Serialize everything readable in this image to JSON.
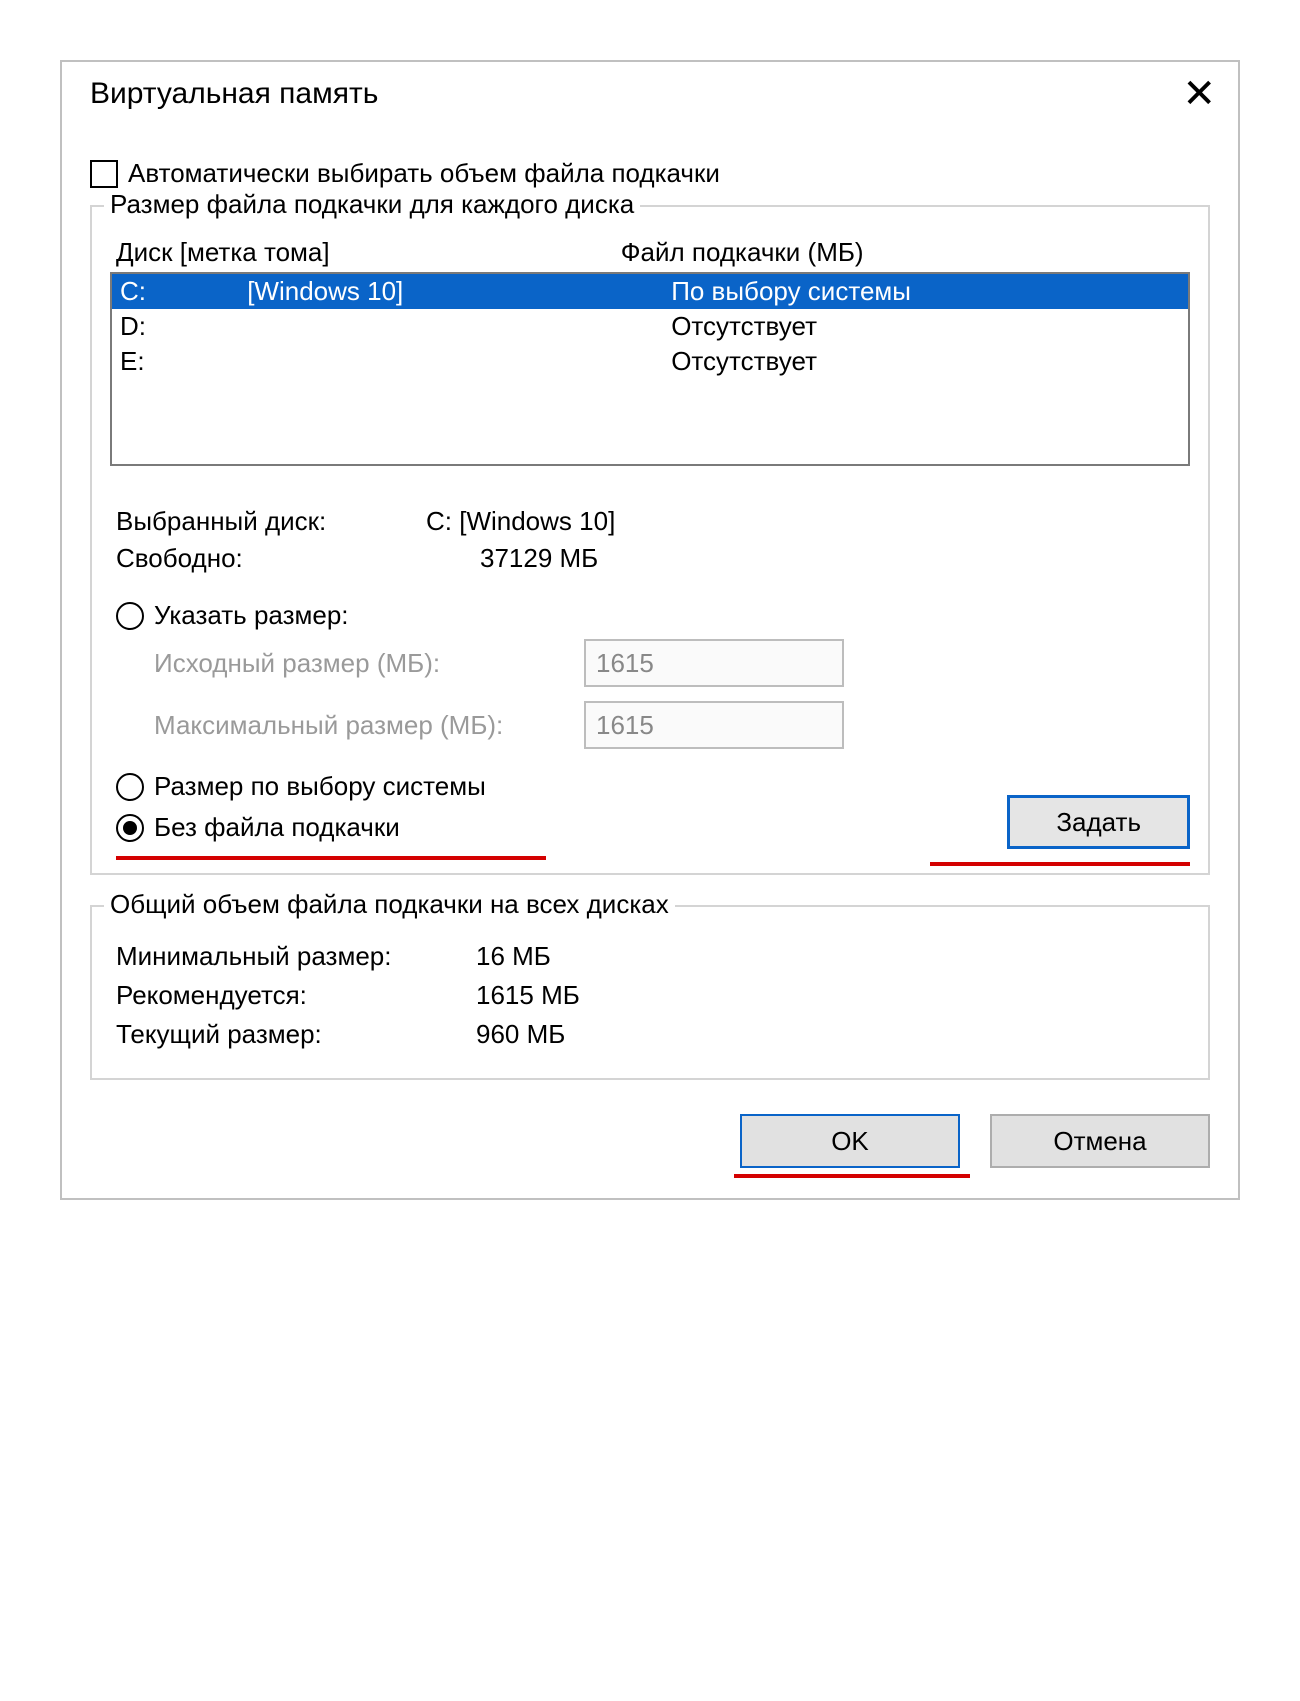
{
  "window": {
    "title": "Виртуальная память"
  },
  "auto_checkbox": {
    "label": "Автоматически выбирать объем файла подкачки",
    "checked": false
  },
  "drive_group": {
    "legend": "Размер файла подкачки для каждого диска",
    "header": {
      "col1": "Диск [метка тома]",
      "col2": "Файл подкачки (МБ)"
    },
    "rows": [
      {
        "drive": "C:",
        "label": "[Windows 10]",
        "status": "По выбору системы",
        "selected": true
      },
      {
        "drive": "D:",
        "label": "",
        "status": "Отсутствует",
        "selected": false
      },
      {
        "drive": "E:",
        "label": "",
        "status": "Отсутствует",
        "selected": false
      }
    ]
  },
  "selected_drive": {
    "label": "Выбранный диск:",
    "value": "C:  [Windows 10]"
  },
  "free_space": {
    "label": "Свободно:",
    "value": "37129 МБ"
  },
  "radio_custom": {
    "label": "Указать размер:"
  },
  "initial_size": {
    "label": "Исходный размер (МБ):",
    "value": "1615"
  },
  "max_size": {
    "label": "Максимальный размер (МБ):",
    "value": "1615"
  },
  "radio_system": {
    "label": "Размер по выбору системы"
  },
  "radio_none": {
    "label": "Без файла подкачки"
  },
  "set_button": "Задать",
  "total_group": {
    "legend": "Общий объем файла подкачки на всех дисках",
    "min": {
      "label": "Минимальный размер:",
      "value": "16 МБ"
    },
    "rec": {
      "label": "Рекомендуется:",
      "value": "1615 МБ"
    },
    "cur": {
      "label": "Текущий размер:",
      "value": "960 МБ"
    }
  },
  "buttons": {
    "ok": "OK",
    "cancel": "Отмена"
  }
}
